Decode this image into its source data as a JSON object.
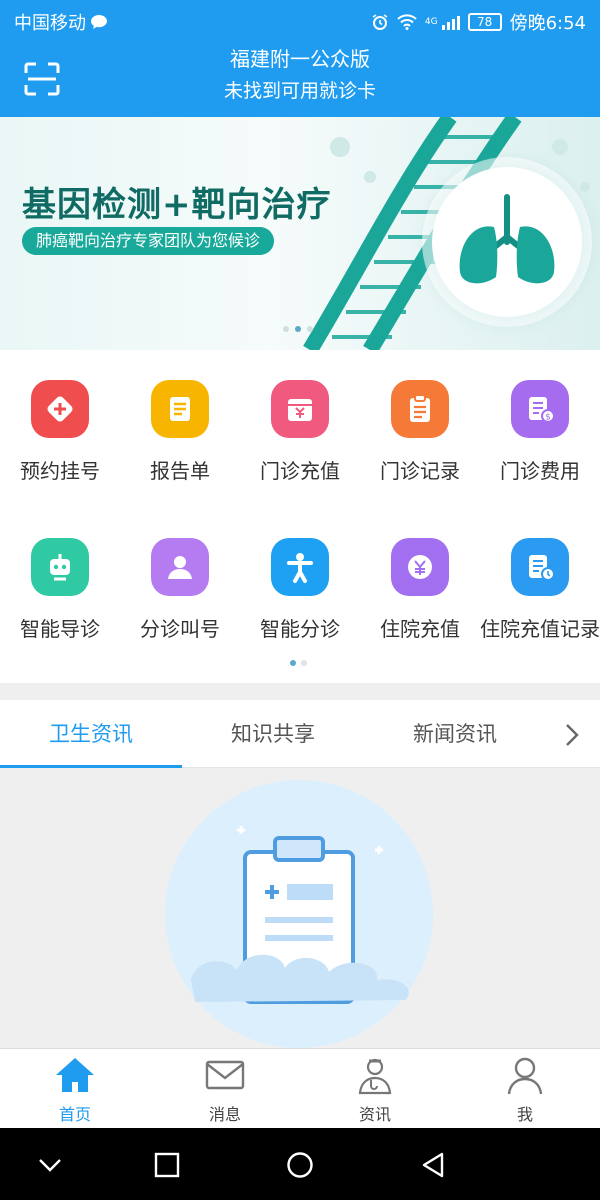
{
  "status_bar": {
    "carrier": "中国移动",
    "network": "4G",
    "battery": "78",
    "time": "傍晚6:54"
  },
  "header": {
    "title": "福建附一公众版",
    "subtitle": "未找到可用就诊卡",
    "scan_icon": "scan-icon"
  },
  "banner": {
    "headline": "基因检测+靶向治疗",
    "tagline": "肺癌靶向治疗专家团队为您候诊",
    "page_count": 3,
    "active_page": 2
  },
  "services": [
    {
      "label": "预约挂号",
      "icon": "plus-diamond-icon",
      "color": "#f04e4e"
    },
    {
      "label": "报告单",
      "icon": "document-icon",
      "color": "#f7b500"
    },
    {
      "label": "门诊充值",
      "icon": "yuan-box-icon",
      "color": "#f05a7e"
    },
    {
      "label": "门诊记录",
      "icon": "clipboard-icon",
      "color": "#f57a38"
    },
    {
      "label": "门诊费用",
      "icon": "bill-icon",
      "color": "#a66cf0"
    },
    {
      "label": "智能导诊",
      "icon": "robot-icon",
      "color": "#2fc9a4"
    },
    {
      "label": "分诊叫号",
      "icon": "person-call-icon",
      "color": "#b57cf2"
    },
    {
      "label": "智能分诊",
      "icon": "person-icon",
      "color": "#1ea1f2"
    },
    {
      "label": "住院充值",
      "icon": "yuan-circle-icon",
      "color": "#a26ff0"
    },
    {
      "label": "住院充值记录",
      "icon": "record-clock-icon",
      "color": "#2a9bf0"
    }
  ],
  "grid_pages": {
    "count": 2,
    "active": 1
  },
  "tabs": [
    {
      "label": "卫生资讯",
      "active": true
    },
    {
      "label": "知识共享",
      "active": false
    },
    {
      "label": "新闻资讯",
      "active": false
    }
  ],
  "bottom_nav": [
    {
      "label": "首页",
      "icon": "home-icon",
      "active": true
    },
    {
      "label": "消息",
      "icon": "envelope-icon",
      "active": false
    },
    {
      "label": "资讯",
      "icon": "doctor-icon",
      "active": false
    },
    {
      "label": "我",
      "icon": "user-icon",
      "active": false
    }
  ],
  "colors": {
    "primary": "#1f9cf0",
    "banner_text": "#0f6b63",
    "banner_badge": "#18a99a"
  }
}
